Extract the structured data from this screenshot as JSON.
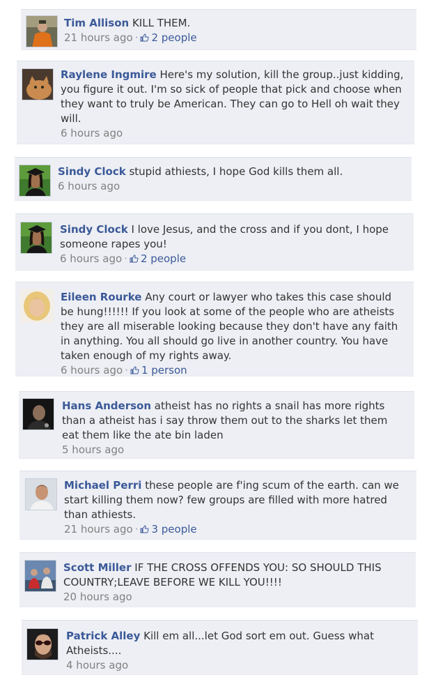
{
  "comments": [
    {
      "author": "Tim Allison",
      "text": "KILL THEM.",
      "time": "21 hours ago",
      "likes": "2 people",
      "avatar_icon": "user-photo-hunter"
    },
    {
      "author": "Raylene Ingmire",
      "text": "Here's my solution, kill the group..just kidding, you figure it out. I'm so sick of people that pick and choose when they want to truly be American. They can go to Hell oh wait they will.",
      "time": "6 hours ago",
      "likes": null,
      "avatar_icon": "user-photo-cat"
    },
    {
      "author": "Sindy Clock",
      "text": "stupid athiests, I hope God kills them all.",
      "time": "6 hours ago",
      "likes": null,
      "avatar_icon": "user-photo-graduate"
    },
    {
      "author": "Sindy Clock",
      "text": "I love Jesus, and the cross and if you dont, I hope someone rapes you!",
      "time": "6 hours ago",
      "likes": "2 people",
      "avatar_icon": "user-photo-graduate"
    },
    {
      "author": "Eileen Rourke",
      "text": "Any court or lawyer who takes this case should be hung!!!!!! If you look at some of the people who are atheists they are all miserable looking because they don't have any faith in anything. You all should go live in another country. You have taken enough of my rights away.",
      "time": "6 hours ago",
      "likes": "1 person",
      "avatar_icon": "user-photo-blonde"
    },
    {
      "author": "Hans Anderson",
      "text": "atheist has no rights a snail has more rights than a atheist has i say throw them out to the sharks let them eat them like the ate bin laden",
      "time": "5 hours ago",
      "likes": null,
      "avatar_icon": "user-photo-dark"
    },
    {
      "author": "Michael Perri",
      "text": "these people are f'ing scum of the earth. can we start killing them now? few groups are filled with more hatred than athiests.",
      "time": "21 hours ago",
      "likes": "3 people",
      "avatar_icon": "user-photo-man"
    },
    {
      "author": "Scott Miller",
      "text": "IF THE CROSS OFFENDS YOU: SO SHOULD THIS COUNTRY;LEAVE BEFORE WE KILL YOU!!!!",
      "time": "20 hours ago",
      "likes": null,
      "avatar_icon": "user-photo-group"
    },
    {
      "author": "Patrick Alley",
      "text": "Kill em all...let God sort em out. Guess what Atheists....",
      "time": "4 hours ago",
      "likes": null,
      "avatar_icon": "user-photo-sunglasses"
    }
  ],
  "colors": {
    "author": "#3b5998",
    "meta": "#808080",
    "card_bg": "#edeff4"
  }
}
